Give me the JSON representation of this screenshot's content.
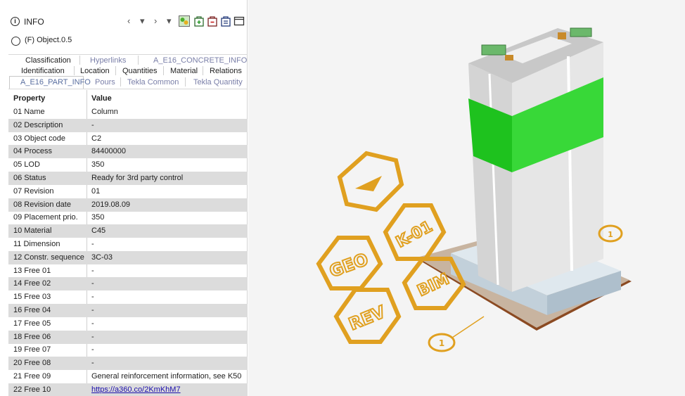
{
  "panel": {
    "title": "INFO",
    "info_glyph": "i",
    "object": "(F) Object.0.5",
    "nav": {
      "prev": "‹",
      "prev_drop": "▾",
      "next": "›",
      "next_drop": "▾"
    },
    "toolbar_icons": [
      "link-objects-icon",
      "add-set-icon",
      "remove-set-icon",
      "edit-set-icon",
      "window-icon"
    ]
  },
  "tabs": {
    "row1": [
      "Classification",
      "Hyperlinks",
      "A_E16_CONCRETE_INFO"
    ],
    "row2": [
      "Identification",
      "Location",
      "Quantities",
      "Material",
      "Relations"
    ],
    "row3": [
      "A_E16_PART_INFO",
      "Pours",
      "Tekla Common",
      "Tekla Quantity"
    ]
  },
  "table": {
    "headers": [
      "Property",
      "Value"
    ],
    "rows": [
      [
        "01 Name",
        "Column"
      ],
      [
        "02 Description",
        "-"
      ],
      [
        "03 Object code",
        "C2"
      ],
      [
        "04 Process",
        "84400000"
      ],
      [
        "05 LOD",
        "350"
      ],
      [
        "06 Status",
        "Ready for 3rd party control"
      ],
      [
        "07 Revision",
        "01"
      ],
      [
        "08 Revision date",
        "2019.08.09"
      ],
      [
        "09 Placement prio.",
        "350"
      ],
      [
        "10 Material",
        "C45"
      ],
      [
        "11 Dimension",
        "-"
      ],
      [
        "12 Constr. sequence",
        "3C-03"
      ],
      [
        "13 Free 01",
        "-"
      ],
      [
        "14 Free 02",
        "-"
      ],
      [
        "15 Free 03",
        "-"
      ],
      [
        "16 Free 04",
        "-"
      ],
      [
        "17 Free 05",
        "-"
      ],
      [
        "18 Free 06",
        "-"
      ],
      [
        "19 Free 07",
        "-"
      ],
      [
        "20 Free 08",
        "-"
      ],
      [
        "21 Free 09",
        "General reinforcement information, see K50"
      ],
      [
        "22 Free 10",
        "https://a360.co/2KmKhM7"
      ]
    ]
  },
  "viewport": {
    "badges": [
      "GEO",
      "K-01",
      "REV",
      "BIM"
    ],
    "grid_label": "1",
    "colors": {
      "highlight": "#1ec21e",
      "badge": "#e0a020",
      "concrete": "#dcdcdc",
      "foundation": "#c7d3dc",
      "base_edge": "#8b4a22"
    }
  }
}
